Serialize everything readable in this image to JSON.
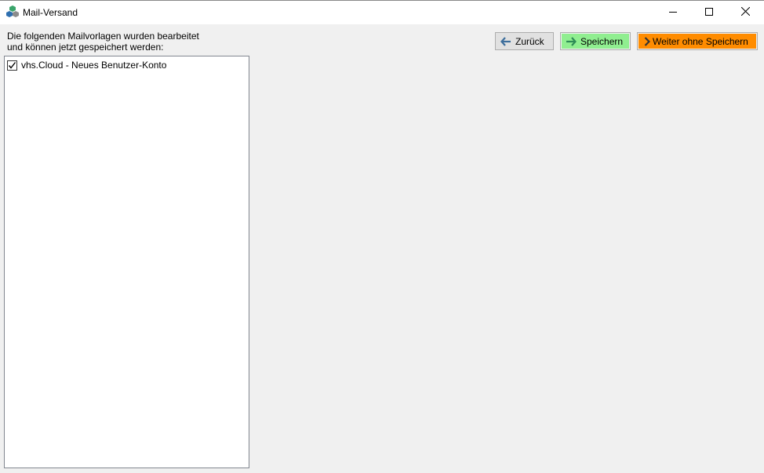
{
  "window": {
    "title": "Mail-Versand",
    "controls": {
      "minimize_icon": "minimize-icon",
      "maximize_icon": "maximize-icon",
      "close_icon": "close-icon"
    }
  },
  "instruction": {
    "line1": "Die folgenden Mailvorlagen wurden bearbeitet",
    "line2": "und können jetzt gespeichert werden:"
  },
  "templates": {
    "items": [
      {
        "label": "vhs.Cloud - Neues Benutzer-Konto",
        "checked": true
      }
    ]
  },
  "toolbar": {
    "back_label": "Zurück",
    "save_label": "Speichern",
    "continue_label": "Weiter ohne Speichern"
  },
  "colors": {
    "save_button_bg": "#90ee90",
    "continue_button_bg": "#ff8c00",
    "back_button_bg": "#e1e1e1",
    "arrow_back": "#3d6e9c",
    "arrow_save": "#2e8b57",
    "arrow_continue": "#333333"
  }
}
